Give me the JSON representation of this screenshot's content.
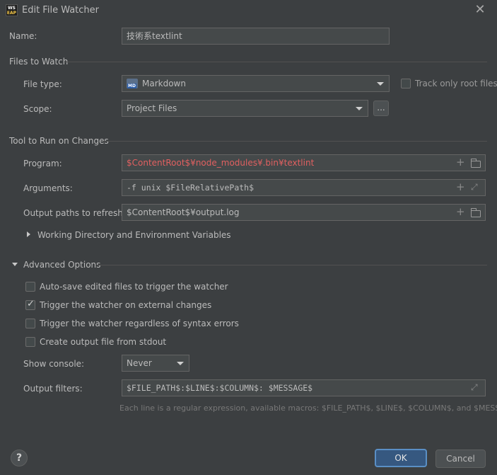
{
  "window": {
    "title": "Edit File Watcher",
    "logo_line1": "WS",
    "logo_line2": "EAP"
  },
  "name": {
    "label": "Name:",
    "value": "技術系textlint"
  },
  "files_to_watch": {
    "title": "Files to Watch",
    "file_type_label": "File type:",
    "file_type_value": "Markdown",
    "track_root_label": "Track only root files",
    "scope_label": "Scope:",
    "scope_value": "Project Files",
    "scope_more": "..."
  },
  "tool": {
    "title": "Tool to Run on Changes",
    "program_label": "Program:",
    "program_value": "$ContentRoot$¥node_modules¥.bin¥textlint",
    "arguments_label": "Arguments:",
    "arguments_value": "-f unix $FileRelativePath$",
    "output_paths_label": "Output paths to refresh:",
    "output_paths_value": "$ContentRoot$¥output.log",
    "working_dir_label": "Working Directory and Environment Variables"
  },
  "advanced": {
    "title": "Advanced Options",
    "autosave_label": "Auto-save edited files to trigger the watcher",
    "autosave_checked": false,
    "external_label": "Trigger the watcher on external changes",
    "external_checked": true,
    "syntax_label": "Trigger the watcher regardless of syntax errors",
    "syntax_checked": false,
    "stdout_label": "Create output file from stdout",
    "stdout_checked": false,
    "show_console_label": "Show console:",
    "show_console_value": "Never",
    "output_filters_label": "Output filters:",
    "output_filters_value": "$FILE_PATH$:$LINE$:$COLUMN$: $MESSAGE$",
    "hint": "Each line is a regular expression, available macros: $FILE_PATH$, $LINE$, $COLUMN$, and $MESSAGE$"
  },
  "footer": {
    "help": "?",
    "ok": "OK",
    "cancel": "Cancel"
  },
  "colors": {
    "background": "#3c3f41",
    "field": "#45494a",
    "accent": "#365880",
    "error_text": "#e06060"
  }
}
